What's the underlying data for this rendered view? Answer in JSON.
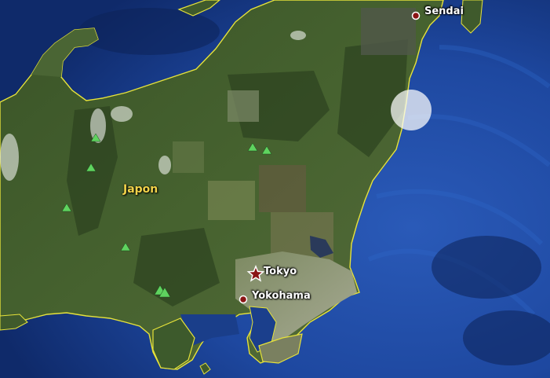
{
  "map": {
    "country_label": "Japon",
    "cities": [
      {
        "id": "sendai",
        "name": "Sendai",
        "marker": "city-dot-icon"
      },
      {
        "id": "tokyo",
        "name": "Tokyo",
        "marker": "capital-star-icon"
      },
      {
        "id": "yokohama",
        "name": "Yokohama",
        "marker": "city-dot-icon"
      }
    ],
    "peak_marker": "mountain-peak-icon",
    "highlight_marker": "highlight-circle-icon",
    "colors": {
      "ocean": "#1e48a0",
      "ocean_deep": "#0f2a6a",
      "land": "#3f5a2c",
      "land_dark": "#2a3f1e",
      "coastline": "#e6e23a",
      "label_country": "#f2d34a",
      "city_dot": "#8a1414",
      "peak": "#5fd35f",
      "highlight": "#ffffff"
    }
  }
}
